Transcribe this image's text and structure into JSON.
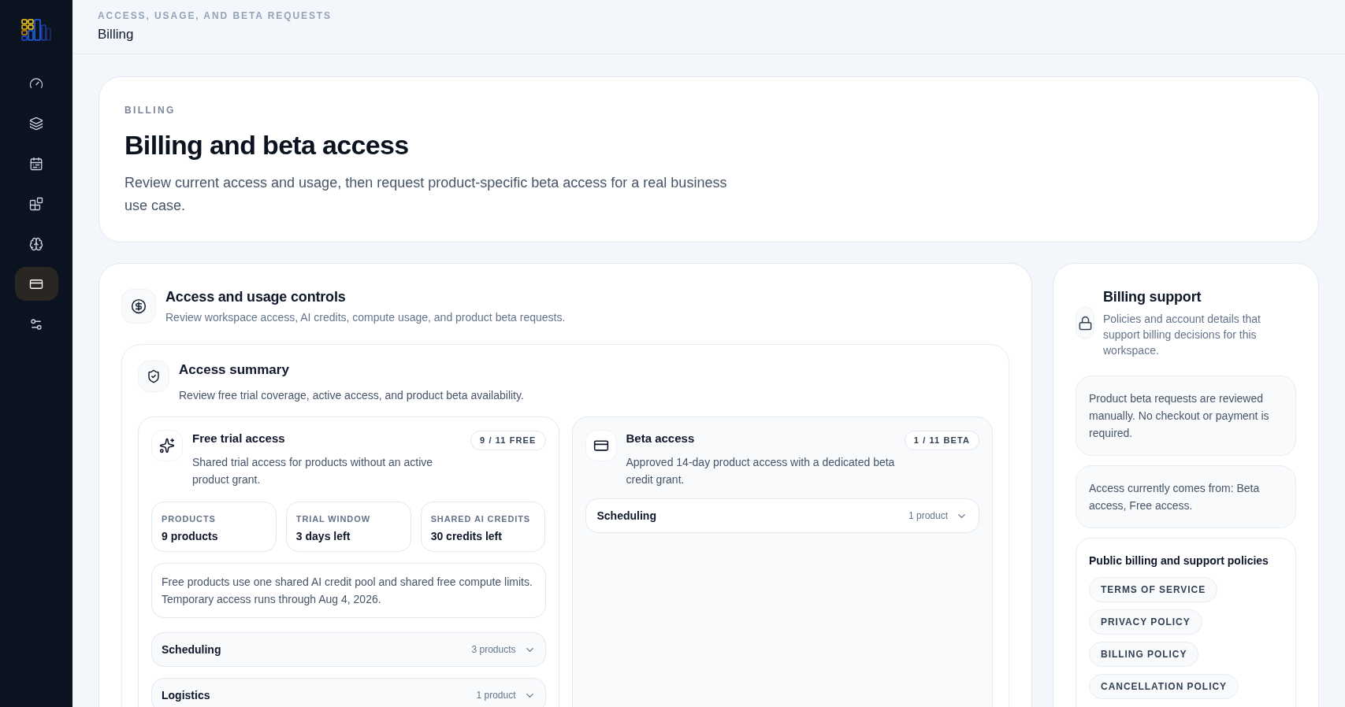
{
  "sidebar": {
    "items": [
      {
        "selected": false
      },
      {
        "selected": false
      },
      {
        "selected": false
      },
      {
        "selected": false
      },
      {
        "selected": false
      },
      {
        "selected": true
      },
      {
        "selected": false
      }
    ]
  },
  "header": {
    "eyebrow": "ACCESS, USAGE, AND BETA REQUESTS",
    "title": "Billing"
  },
  "hero": {
    "eyebrow": "BILLING",
    "title": "Billing and beta access",
    "description": "Review current access and usage, then request product-specific beta access for a real business use case."
  },
  "controls": {
    "title": "Access and usage controls",
    "subtitle": "Review workspace access, AI credits, compute usage, and product beta requests.",
    "summary": {
      "title": "Access summary",
      "subtitle": "Review free trial coverage, active access, and product beta availability.",
      "free_trial": {
        "title": "Free trial access",
        "description": "Shared trial access for products without an active product grant.",
        "badge": "9 / 11 FREE",
        "stats": [
          {
            "label": "PRODUCTS",
            "value": "9 products"
          },
          {
            "label": "TRIAL WINDOW",
            "value": "3 days left"
          },
          {
            "label": "SHARED AI CREDITS",
            "value": "30 credits left"
          }
        ],
        "note": "Free products use one shared AI credit pool and shared free compute limits. Temporary access runs through Aug 4, 2026.",
        "groups": [
          {
            "name": "Scheduling",
            "count": "3 products",
            "expanded": false
          },
          {
            "name": "Logistics",
            "count": "1 product",
            "expanded": false
          }
        ]
      },
      "beta": {
        "title": "Beta access",
        "description": "Approved 14-day product access with a dedicated beta credit grant.",
        "badge": "1 / 11 BETA",
        "groups": [
          {
            "name": "Scheduling",
            "count": "1 product",
            "expanded": false
          }
        ]
      }
    }
  },
  "support": {
    "title": "Billing support",
    "description": "Policies and account details that support billing decisions for this workspace.",
    "notes": [
      "Product beta requests are reviewed manually. No checkout or payment is required.",
      "Access currently comes from: Beta access, Free access."
    ],
    "policies": {
      "title": "Public billing and support policies",
      "links": [
        "TERMS OF SERVICE",
        "PRIVACY POLICY",
        "BILLING POLICY",
        "CANCELLATION POLICY"
      ]
    }
  }
}
